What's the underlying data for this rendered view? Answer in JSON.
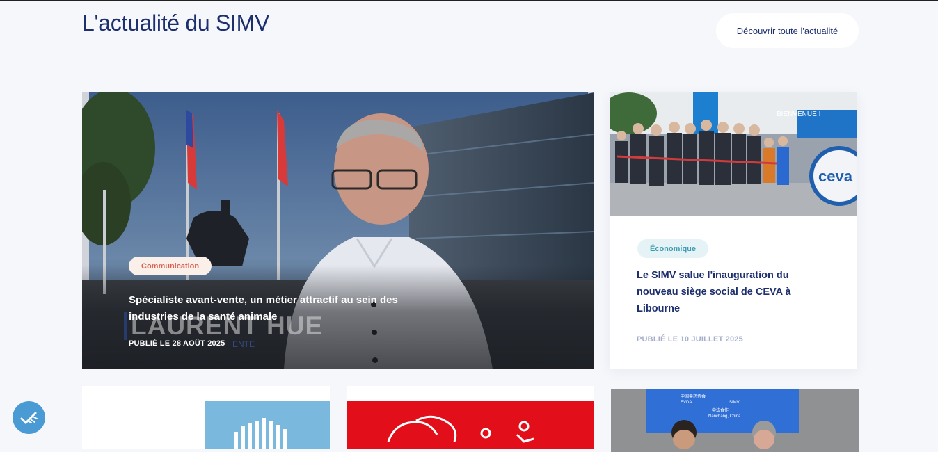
{
  "header": {
    "title": "L'actualité du SIMV",
    "discover_label": "Découvrir toute l'actualité"
  },
  "featured": {
    "category": "Communication",
    "title": "Spécialiste avant-vente, un métier attractif au sein des industries de la santé animale",
    "date": "PUBLIÉ LE 28 AOÛT 2025",
    "overlay_name": "LAURENT HUE",
    "overlay_sub": "ENTE"
  },
  "side_article": {
    "category": "Économique",
    "title": "Le SIMV salue l'inauguration du nouveau siège social de CEVA à Libourne",
    "date": "PUBLIÉ LE 10 JUILLET 2025",
    "photo_sign": "BIENVENUE !",
    "photo_logo": "ceva"
  },
  "bottom_cards": [
    {
      "image": "bar-chart-cow-illustration"
    },
    {
      "image": "red-animal-health-illustration"
    },
    {
      "image": "conference-photo",
      "screen_lines": [
        "中国兽药协会",
        "EVDA",
        "SIMV",
        "中法合作",
        "Nanchang, China"
      ]
    }
  ],
  "colors": {
    "navy": "#1d2f6f",
    "communication_tag": "#d9604f",
    "economique_tag": "#3a9bb0",
    "fab": "#4a9bd4"
  },
  "icons": {
    "fab": "accessibility-check-icon"
  }
}
